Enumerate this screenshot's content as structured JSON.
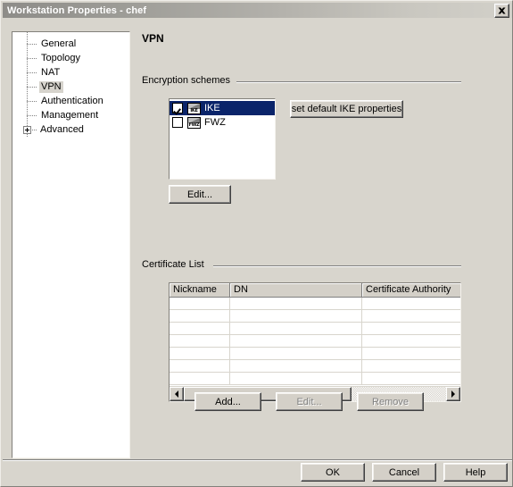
{
  "window": {
    "title": "Workstation Properties - chef",
    "close_label": "Close"
  },
  "sidebar": {
    "items": [
      {
        "label": "General",
        "selected": false,
        "expander": false
      },
      {
        "label": "Topology",
        "selected": false,
        "expander": false
      },
      {
        "label": "NAT",
        "selected": false,
        "expander": false
      },
      {
        "label": "VPN",
        "selected": true,
        "expander": false
      },
      {
        "label": "Authentication",
        "selected": false,
        "expander": false
      },
      {
        "label": "Management",
        "selected": false,
        "expander": false
      },
      {
        "label": "Advanced",
        "selected": false,
        "expander": true
      }
    ]
  },
  "page": {
    "title": "VPN"
  },
  "encryption": {
    "group_label": "Encryption schemes",
    "items": [
      {
        "label": "IKE",
        "icon": "ike-scheme-icon",
        "code": "IKE",
        "checked": true,
        "selected": true
      },
      {
        "label": "FWZ",
        "icon": "fwz-scheme-icon",
        "code": "FWZ",
        "checked": false,
        "selected": false
      }
    ],
    "set_default_label": "set default IKE properties",
    "edit_label": "Edit..."
  },
  "certificates": {
    "group_label": "Certificate List",
    "columns": [
      "Nickname",
      "DN",
      "Certificate Authority"
    ],
    "rows": [],
    "empty_row_count": 7,
    "scrollbar": {
      "left_arrow": "scroll-left-icon",
      "right_arrow": "scroll-right-icon",
      "thumb_fraction": 0.64
    },
    "add_label": "Add...",
    "edit_label": "Edit...",
    "remove_label": "Remove",
    "add_enabled": true,
    "edit_enabled": false,
    "remove_enabled": false
  },
  "dialog_buttons": {
    "ok_label": "OK",
    "cancel_label": "Cancel",
    "help_label": "Help"
  },
  "colors": {
    "face": "#d8d5cd",
    "button_face": "#d4d0c8",
    "selection": "#0a246a",
    "tree_selection": "#d6d3cc",
    "title_text": "#ffffff"
  }
}
